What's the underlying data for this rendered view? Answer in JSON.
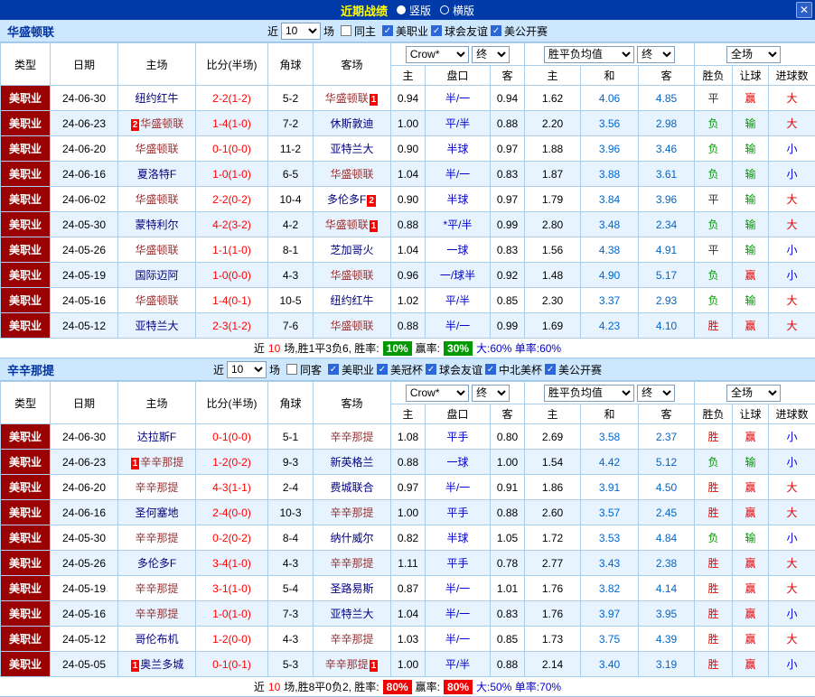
{
  "topbar": {
    "title": "近期战绩",
    "vertical_label": "竖版",
    "horizontal_label": "横版",
    "close_label": "✕"
  },
  "table_headers": {
    "cols": [
      "类型",
      "日期",
      "主场",
      "比分(半场)",
      "角球",
      "客场"
    ],
    "asia_sub": [
      "主",
      "盘口",
      "客"
    ],
    "eu_sub": [
      "主",
      "和",
      "客"
    ],
    "result_sub": [
      "胜负",
      "让球",
      "进球数"
    ]
  },
  "colors": {
    "green_badge": "#009900",
    "red_badge": "#f00000"
  },
  "sections": [
    {
      "team": "华盛顿联",
      "filter": {
        "near": "近",
        "count": "10",
        "games": "场",
        "same": {
          "label": "同主",
          "checked": false
        },
        "leagues": [
          "美职业",
          "球会友谊",
          "美公开赛"
        ]
      },
      "selects": {
        "bookmaker": "Crow*",
        "end1": "终",
        "avg": "胜平负均值",
        "end2": "终",
        "scope": "全场"
      },
      "rows": [
        {
          "league": "美职业",
          "date": "24-06-30",
          "home": {
            "name": "纽约红牛"
          },
          "score": "2-2(1-2)",
          "corner": "5-2",
          "away": {
            "name": "华盛顿联",
            "focus": true,
            "badge": "1",
            "badge_pos": "after"
          },
          "ah": "0.94",
          "handicap": "半/一",
          "aa": "0.94",
          "eh": "1.62",
          "ed": "4.06",
          "ea": "4.85",
          "res": "平",
          "hres": "赢",
          "goal": "大"
        },
        {
          "league": "美职业",
          "date": "24-06-23",
          "home": {
            "name": "华盛顿联",
            "focus": true,
            "badge": "2",
            "badge_pos": "before"
          },
          "score": "1-4(1-0)",
          "corner": "7-2",
          "away": {
            "name": "休斯敦迪"
          },
          "ah": "1.00",
          "handicap": "平/半",
          "aa": "0.88",
          "eh": "2.20",
          "ed": "3.56",
          "ea": "2.98",
          "res": "负",
          "hres": "输",
          "goal": "大"
        },
        {
          "league": "美职业",
          "date": "24-06-20",
          "home": {
            "name": "华盛顿联",
            "focus": true
          },
          "score": "0-1(0-0)",
          "corner": "11-2",
          "away": {
            "name": "亚特兰大"
          },
          "ah": "0.90",
          "handicap": "半球",
          "aa": "0.97",
          "eh": "1.88",
          "ed": "3.96",
          "ea": "3.46",
          "res": "负",
          "hres": "输",
          "goal": "小"
        },
        {
          "league": "美职业",
          "date": "24-06-16",
          "home": {
            "name": "夏洛特F"
          },
          "score": "1-0(1-0)",
          "corner": "6-5",
          "away": {
            "name": "华盛顿联",
            "focus": true
          },
          "ah": "1.04",
          "handicap": "半/一",
          "aa": "0.83",
          "eh": "1.87",
          "ed": "3.88",
          "ea": "3.61",
          "res": "负",
          "hres": "输",
          "goal": "小"
        },
        {
          "league": "美职业",
          "date": "24-06-02",
          "home": {
            "name": "华盛顿联",
            "focus": true
          },
          "score": "2-2(0-2)",
          "corner": "10-4",
          "away": {
            "name": "多伦多F",
            "badge": "2",
            "badge_pos": "after"
          },
          "ah": "0.90",
          "handicap": "半球",
          "aa": "0.97",
          "eh": "1.79",
          "ed": "3.84",
          "ea": "3.96",
          "res": "平",
          "hres": "输",
          "goal": "大"
        },
        {
          "league": "美职业",
          "date": "24-05-30",
          "home": {
            "name": "蒙特利尔"
          },
          "score": "4-2(3-2)",
          "corner": "4-2",
          "away": {
            "name": "华盛顿联",
            "focus": true,
            "badge": "1",
            "badge_pos": "after"
          },
          "ah": "0.88",
          "handicap": "*平/半",
          "aa": "0.99",
          "eh": "2.80",
          "ed": "3.48",
          "ea": "2.34",
          "res": "负",
          "hres": "输",
          "goal": "大"
        },
        {
          "league": "美职业",
          "date": "24-05-26",
          "home": {
            "name": "华盛顿联",
            "focus": true
          },
          "score": "1-1(1-0)",
          "corner": "8-1",
          "away": {
            "name": "芝加哥火"
          },
          "ah": "1.04",
          "handicap": "一球",
          "aa": "0.83",
          "eh": "1.56",
          "ed": "4.38",
          "ea": "4.91",
          "res": "平",
          "hres": "输",
          "goal": "小"
        },
        {
          "league": "美职业",
          "date": "24-05-19",
          "home": {
            "name": "国际迈阿"
          },
          "score": "1-0(0-0)",
          "corner": "4-3",
          "away": {
            "name": "华盛顿联",
            "focus": true
          },
          "ah": "0.96",
          "handicap": "一/球半",
          "aa": "0.92",
          "eh": "1.48",
          "ed": "4.90",
          "ea": "5.17",
          "res": "负",
          "hres": "赢",
          "goal": "小"
        },
        {
          "league": "美职业",
          "date": "24-05-16",
          "home": {
            "name": "华盛顿联",
            "focus": true
          },
          "score": "1-4(0-1)",
          "corner": "10-5",
          "away": {
            "name": "纽约红牛"
          },
          "ah": "1.02",
          "handicap": "平/半",
          "aa": "0.85",
          "eh": "2.30",
          "ed": "3.37",
          "ea": "2.93",
          "res": "负",
          "hres": "输",
          "goal": "大"
        },
        {
          "league": "美职业",
          "date": "24-05-12",
          "home": {
            "name": "亚特兰大"
          },
          "score": "2-3(1-2)",
          "corner": "7-6",
          "away": {
            "name": "华盛顿联",
            "focus": true
          },
          "ah": "0.88",
          "handicap": "半/一",
          "aa": "0.99",
          "eh": "1.69",
          "ed": "4.23",
          "ea": "4.10",
          "res": "胜",
          "hres": "赢",
          "goal": "大"
        }
      ],
      "footer": {
        "prefix": "近",
        "count": "10",
        "summary": "场,胜1平3负6, 胜率:",
        "win_rate": "10%",
        "badge_color": "#009900",
        "profit_label": "赢率:",
        "profit_rate": "30%",
        "extra": "大:60% 单率:60%"
      }
    },
    {
      "team": "辛辛那提",
      "filter": {
        "near": "近",
        "count": "10",
        "games": "场",
        "same": {
          "label": "同客",
          "checked": false
        },
        "leagues": [
          "美职业",
          "美冠杯",
          "球会友谊",
          "中北美杯",
          "美公开赛"
        ]
      },
      "selects": {
        "bookmaker": "Crow*",
        "end1": "终",
        "avg": "胜平负均值",
        "end2": "终",
        "scope": "全场"
      },
      "rows": [
        {
          "league": "美职业",
          "date": "24-06-30",
          "home": {
            "name": "达拉斯F"
          },
          "score": "0-1(0-0)",
          "corner": "5-1",
          "away": {
            "name": "辛辛那提",
            "focus": true
          },
          "ah": "1.08",
          "handicap": "平手",
          "aa": "0.80",
          "eh": "2.69",
          "ed": "3.58",
          "ea": "2.37",
          "res": "胜",
          "hres": "赢",
          "goal": "小"
        },
        {
          "league": "美职业",
          "date": "24-06-23",
          "home": {
            "name": "辛辛那提",
            "focus": true,
            "badge": "1",
            "badge_pos": "before"
          },
          "score": "1-2(0-2)",
          "corner": "9-3",
          "away": {
            "name": "新英格兰"
          },
          "ah": "0.88",
          "handicap": "一球",
          "aa": "1.00",
          "eh": "1.54",
          "ed": "4.42",
          "ea": "5.12",
          "res": "负",
          "hres": "输",
          "goal": "小"
        },
        {
          "league": "美职业",
          "date": "24-06-20",
          "home": {
            "name": "辛辛那提",
            "focus": true
          },
          "score": "4-3(1-1)",
          "corner": "2-4",
          "away": {
            "name": "费城联合"
          },
          "ah": "0.97",
          "handicap": "半/一",
          "aa": "0.91",
          "eh": "1.86",
          "ed": "3.91",
          "ea": "4.50",
          "res": "胜",
          "hres": "赢",
          "goal": "大"
        },
        {
          "league": "美职业",
          "date": "24-06-16",
          "home": {
            "name": "圣何塞地"
          },
          "score": "2-4(0-0)",
          "corner": "10-3",
          "away": {
            "name": "辛辛那提",
            "focus": true
          },
          "ah": "1.00",
          "handicap": "平手",
          "aa": "0.88",
          "eh": "2.60",
          "ed": "3.57",
          "ea": "2.45",
          "res": "胜",
          "hres": "赢",
          "goal": "大"
        },
        {
          "league": "美职业",
          "date": "24-05-30",
          "home": {
            "name": "辛辛那提",
            "focus": true
          },
          "score": "0-2(0-2)",
          "corner": "8-4",
          "away": {
            "name": "纳什威尔"
          },
          "ah": "0.82",
          "handicap": "半球",
          "aa": "1.05",
          "eh": "1.72",
          "ed": "3.53",
          "ea": "4.84",
          "res": "负",
          "hres": "输",
          "goal": "小"
        },
        {
          "league": "美职业",
          "date": "24-05-26",
          "home": {
            "name": "多伦多F"
          },
          "score": "3-4(1-0)",
          "corner": "4-3",
          "away": {
            "name": "辛辛那提",
            "focus": true
          },
          "ah": "1.11",
          "handicap": "平手",
          "aa": "0.78",
          "eh": "2.77",
          "ed": "3.43",
          "ea": "2.38",
          "res": "胜",
          "hres": "赢",
          "goal": "大"
        },
        {
          "league": "美职业",
          "date": "24-05-19",
          "home": {
            "name": "辛辛那提",
            "focus": true
          },
          "score": "3-1(1-0)",
          "corner": "5-4",
          "away": {
            "name": "圣路易斯"
          },
          "ah": "0.87",
          "handicap": "半/一",
          "aa": "1.01",
          "eh": "1.76",
          "ed": "3.82",
          "ea": "4.14",
          "res": "胜",
          "hres": "赢",
          "goal": "大"
        },
        {
          "league": "美职业",
          "date": "24-05-16",
          "home": {
            "name": "辛辛那提",
            "focus": true
          },
          "score": "1-0(1-0)",
          "corner": "7-3",
          "away": {
            "name": "亚特兰大"
          },
          "ah": "1.04",
          "handicap": "半/一",
          "aa": "0.83",
          "eh": "1.76",
          "ed": "3.97",
          "ea": "3.95",
          "res": "胜",
          "hres": "赢",
          "goal": "小"
        },
        {
          "league": "美职业",
          "date": "24-05-12",
          "home": {
            "name": "哥伦布机"
          },
          "score": "1-2(0-0)",
          "corner": "4-3",
          "away": {
            "name": "辛辛那提",
            "focus": true
          },
          "ah": "1.03",
          "handicap": "半/一",
          "aa": "0.85",
          "eh": "1.73",
          "ed": "3.75",
          "ea": "4.39",
          "res": "胜",
          "hres": "赢",
          "goal": "大"
        },
        {
          "league": "美职业",
          "date": "24-05-05",
          "home": {
            "name": "奥兰多城",
            "badge": "1",
            "badge_pos": "before"
          },
          "score": "0-1(0-1)",
          "corner": "5-3",
          "away": {
            "name": "辛辛那提",
            "focus": true,
            "badge": "1",
            "badge_pos": "after"
          },
          "ah": "1.00",
          "handicap": "平/半",
          "aa": "0.88",
          "eh": "2.14",
          "ed": "3.40",
          "ea": "3.19",
          "res": "胜",
          "hres": "赢",
          "goal": "小"
        }
      ],
      "footer": {
        "prefix": "近",
        "count": "10",
        "summary": "场,胜8平0负2, 胜率:",
        "win_rate": "80%",
        "badge_color": "#f00000",
        "profit_label": "赢率:",
        "profit_rate": "80%",
        "extra": "大:50% 单率:70%"
      }
    }
  ]
}
